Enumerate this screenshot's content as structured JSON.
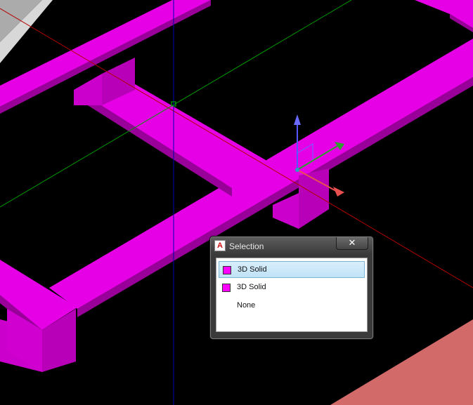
{
  "dialog": {
    "title": "Selection",
    "close_label": "✕",
    "items": [
      {
        "label": "3D Solid",
        "swatch": "#ff00ff"
      },
      {
        "label": "3D Solid",
        "swatch": "#ff00ff"
      },
      {
        "label": "None"
      }
    ]
  },
  "colors": {
    "solid": "#e600e6",
    "axis_x": "#b40000",
    "axis_y": "#009a00",
    "axis_z": "#0000b4"
  }
}
